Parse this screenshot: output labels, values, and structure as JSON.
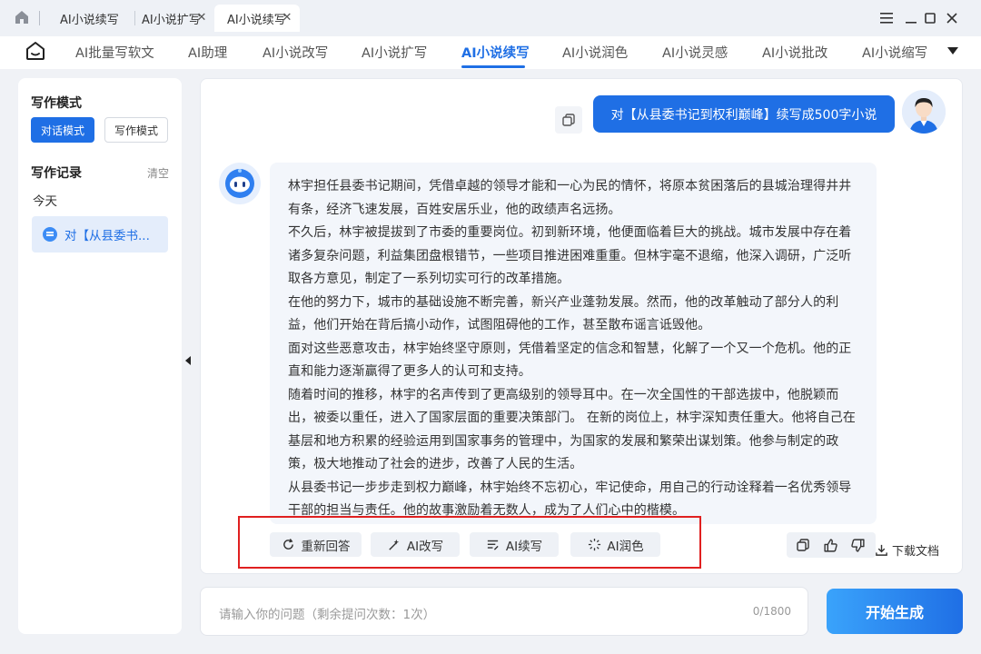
{
  "tabs": [
    {
      "label": "AI小说续写"
    },
    {
      "label": "AI小说扩写"
    },
    {
      "label": "AI小说续写"
    }
  ],
  "nav": {
    "items": [
      "AI批量写软文",
      "AI助理",
      "AI小说改写",
      "AI小说扩写",
      "AI小说续写",
      "AI小说润色",
      "AI小说灵感",
      "AI小说批改",
      "AI小说缩写"
    ],
    "active_index": 4
  },
  "sidebar": {
    "mode_title": "写作模式",
    "mode_chat": "对话模式",
    "mode_write": "写作模式",
    "history_title": "写作记录",
    "clear_label": "清空",
    "today_label": "今天",
    "record_label": "对【从县委书..."
  },
  "chat": {
    "user_message": "对【从县委书记到权利巅峰】续写成500字小说",
    "answer_paragraphs": [
      "林宇担任县委书记期间，凭借卓越的领导才能和一心为民的情怀，将原本贫困落后的县城治理得井井有条，经济飞速发展，百姓安居乐业，他的政绩声名远扬。",
      "不久后，林宇被提拔到了市委的重要岗位。初到新环境，他便面临着巨大的挑战。城市发展中存在着诸多复杂问题，利益集团盘根错节，一些项目推进困难重重。但林宇毫不退缩，他深入调研，广泛听取各方意见，制定了一系列切实可行的改革措施。",
      "在他的努力下，城市的基础设施不断完善，新兴产业蓬勃发展。然而，他的改革触动了部分人的利益，他们开始在背后搞小动作，试图阻碍他的工作，甚至散布谣言诋毁他。",
      "面对这些恶意攻击，林宇始终坚守原则，凭借着坚定的信念和智慧，化解了一个又一个危机。他的正直和能力逐渐赢得了更多人的认可和支持。",
      "随着时间的推移，林宇的名声传到了更高级别的领导耳中。在一次全国性的干部选拔中，他脱颖而出，被委以重任，进入了国家层面的重要决策部门。 在新的岗位上，林宇深知责任重大。他将自己在基层和地方积累的经验运用到国家事务的管理中，为国家的发展和繁荣出谋划策。他参与制定的政策，极大地推动了社会的进步，改善了人民的生活。",
      "从县委书记一步步走到权力巅峰，林宇始终不忘初心，牢记使命，用自己的行动诠释着一名优秀领导干部的担当与责任。他的故事激励着无数人，成为了人们心中的楷模。"
    ],
    "actions": {
      "regenerate": "重新回答",
      "rewrite": "AI改写",
      "continue": "AI续写",
      "polish": "AI润色"
    },
    "download_label": "下载文档"
  },
  "input": {
    "placeholder": "请输入你的问题（剩余提问次数：1次）",
    "counter": "0/1800"
  },
  "generate_label": "开始生成",
  "colors": {
    "accent": "#1f6fe5",
    "highlight_box": "#e02020"
  }
}
